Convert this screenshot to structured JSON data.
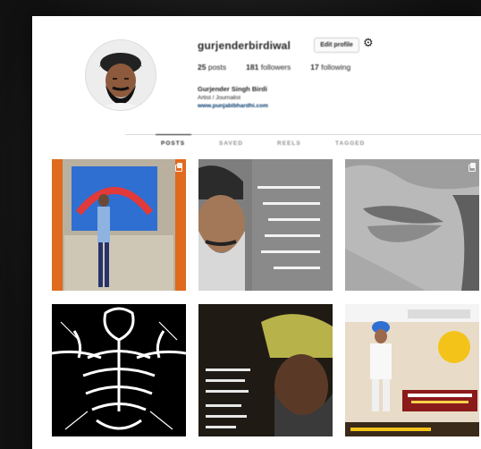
{
  "profile": {
    "username": "gurjenderbirdiwal",
    "edit_label": "Edit profile",
    "settings_icon": "gear-icon",
    "stats": [
      {
        "count": "25",
        "label": "posts"
      },
      {
        "count": "181",
        "label": "followers"
      },
      {
        "count": "17",
        "label": "following"
      }
    ],
    "full_name": "Gurjender Singh Birdi",
    "bio": "Artist / Journalist",
    "website": "www.punjabibhardhi.com"
  },
  "tabs": [
    {
      "label": "POSTS",
      "active": true
    },
    {
      "label": "SAVED",
      "active": false
    },
    {
      "label": "REELS",
      "active": false
    },
    {
      "label": "TAGGED",
      "active": false
    }
  ],
  "posts": [
    {
      "name": "stage-performance-post",
      "multi": true
    },
    {
      "name": "turban-man-poem-post",
      "multi": false
    },
    {
      "name": "lips-closeup-post",
      "multi": true
    },
    {
      "name": "skeleton-sketch-post",
      "multi": false
    },
    {
      "name": "yellow-turban-poem-post",
      "multi": false
    },
    {
      "name": "poster-white-suit-post",
      "multi": false
    }
  ]
}
